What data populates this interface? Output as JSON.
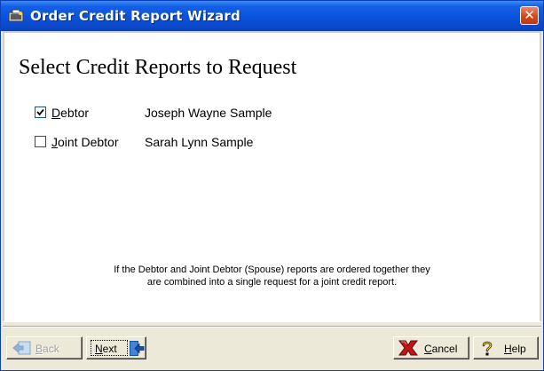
{
  "window": {
    "title": "Order Credit Report Wizard",
    "close_label": "✕",
    "icon": "wizard-app-icon"
  },
  "main": {
    "heading": "Select Credit Reports to Request",
    "rows": [
      {
        "label_mnemonic": "D",
        "label_rest": "ebtor",
        "name": "Joseph Wayne Sample",
        "checked": true
      },
      {
        "label_mnemonic": "J",
        "label_rest": "oint Debtor",
        "name": "Sarah Lynn Sample",
        "checked": false
      }
    ],
    "note_line1": "If the Debtor and Joint Debtor (Spouse) reports are ordered together they",
    "note_line2": "are combined into a single request for a joint credit report."
  },
  "footer": {
    "back": {
      "mnemonic": "B",
      "rest": "ack",
      "enabled": false,
      "icon": "back-arrow-icon"
    },
    "next": {
      "mnemonic": "N",
      "rest": "ext",
      "enabled": true,
      "icon": "next-arrow-icon"
    },
    "cancel": {
      "mnemonic": "C",
      "rest": "ancel",
      "icon": "red-x-icon"
    },
    "help": {
      "mnemonic": "H",
      "rest": "elp",
      "icon": "question-mark-icon"
    }
  },
  "colors": {
    "titlebar": "#0a52dd",
    "close": "#d2471f",
    "face": "#ece9d8",
    "cancel_icon": "#c0141a"
  }
}
